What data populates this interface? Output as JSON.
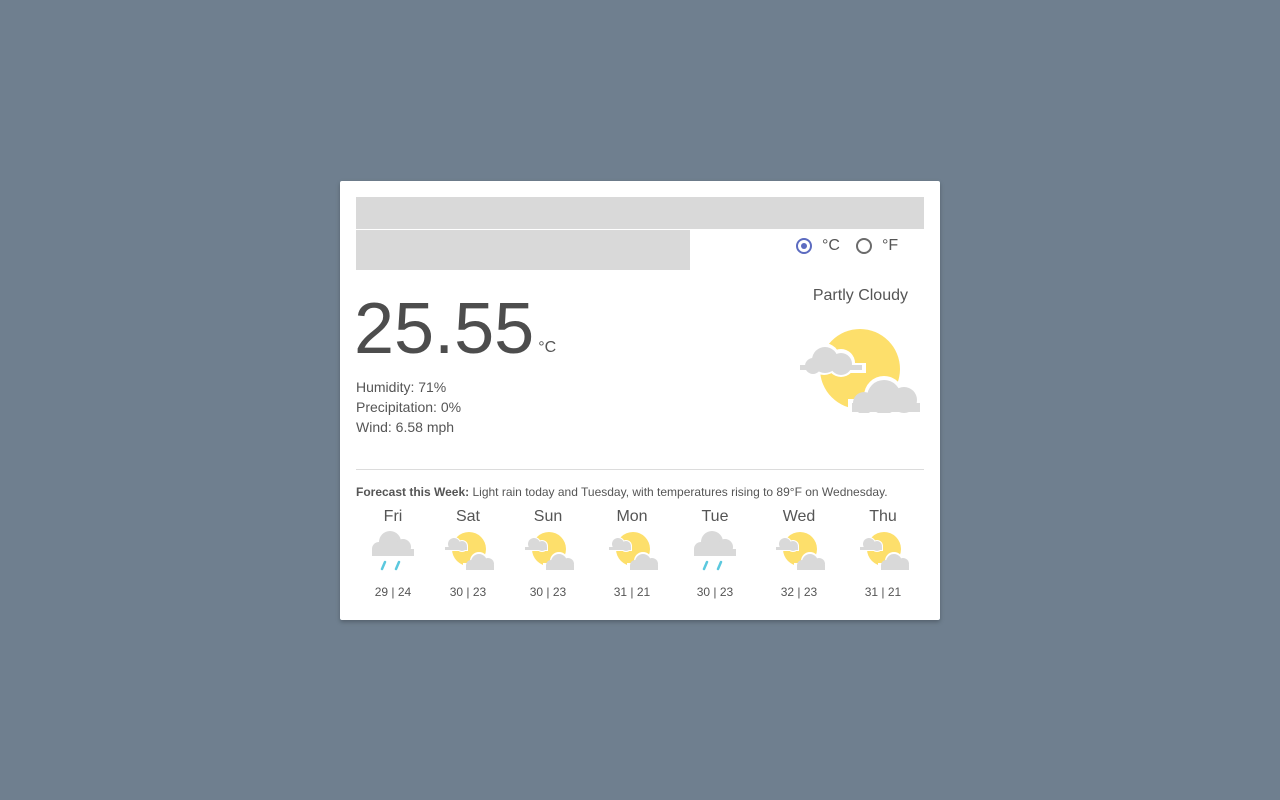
{
  "units": {
    "celsius_label": "°C",
    "fahrenheit_label": "°F",
    "selected": "celsius"
  },
  "current": {
    "temperature": "25.55",
    "unit": "°C",
    "humidity": "Humidity: 71%",
    "precipitation": "Precipitation: 0%",
    "wind": "Wind: 6.58 mph",
    "condition": "Partly Cloudy",
    "icon": "partly-cloudy-icon"
  },
  "forecast": {
    "label": "Forecast this Week:",
    "summary": " Light rain today and Tuesday, with temperatures rising to 89°F on Wednesday.",
    "days": [
      {
        "name": "Fri",
        "icon": "rain-icon",
        "temps": "29 | 24"
      },
      {
        "name": "Sat",
        "icon": "partly-cloudy-icon",
        "temps": "30 | 23"
      },
      {
        "name": "Sun",
        "icon": "partly-cloudy-icon",
        "temps": "30 | 23"
      },
      {
        "name": "Mon",
        "icon": "partly-cloudy-icon",
        "temps": "31 | 21"
      },
      {
        "name": "Tue",
        "icon": "rain-icon",
        "temps": "30 | 23"
      },
      {
        "name": "Wed",
        "icon": "partly-cloudy-icon",
        "temps": "32 | 23"
      },
      {
        "name": "Thu",
        "icon": "partly-cloudy-icon",
        "temps": "31 | 21"
      }
    ]
  },
  "colors": {
    "background": "#6f7f8f",
    "sun": "#fddf6b",
    "cloud": "#d9d9d9",
    "rain": "#5bc8de",
    "radio_accent": "#5c6bc0"
  }
}
